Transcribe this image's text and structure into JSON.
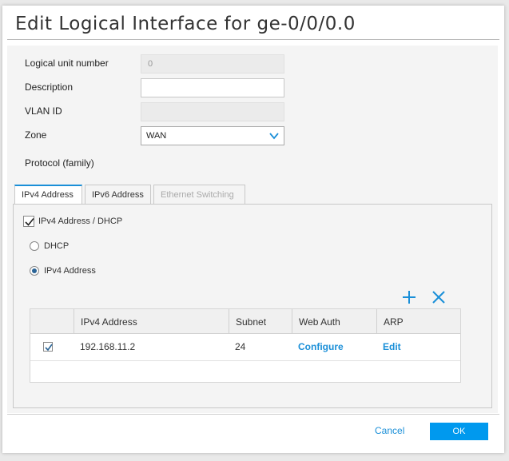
{
  "dialog": {
    "title": "Edit Logical Interface for ge-0/0/0.0"
  },
  "form": {
    "logical_unit": {
      "label": "Logical unit number",
      "value": "0"
    },
    "description": {
      "label": "Description",
      "value": ""
    },
    "vlan_id": {
      "label": "VLAN ID",
      "value": ""
    },
    "zone": {
      "label": "Zone",
      "value": "WAN"
    },
    "protocol_label": "Protocol (family)"
  },
  "tabs": [
    {
      "label": "IPv4 Address",
      "state": "active"
    },
    {
      "label": "IPv6 Address",
      "state": "normal"
    },
    {
      "label": "Ethernet Switching",
      "state": "disabled"
    }
  ],
  "ipv4": {
    "enable_label": "IPv4 Address / DHCP",
    "enable_checked": true,
    "dhcp_label": "DHCP",
    "static_label": "IPv4 Address",
    "selected_mode": "IPv4 Address",
    "add_icon": "plus-icon",
    "delete_icon": "close-icon"
  },
  "table": {
    "columns": [
      "IPv4 Address",
      "Subnet",
      "Web Auth",
      "ARP"
    ],
    "rows": [
      {
        "checked": true,
        "address": "192.168.11.2",
        "subnet": "24",
        "web_auth": "Configure",
        "arp": "Edit"
      }
    ]
  },
  "footer": {
    "cancel_label": "Cancel",
    "ok_label": "OK"
  },
  "colors": {
    "accent": "#1a8fd8",
    "ok_button": "#0099ee"
  }
}
